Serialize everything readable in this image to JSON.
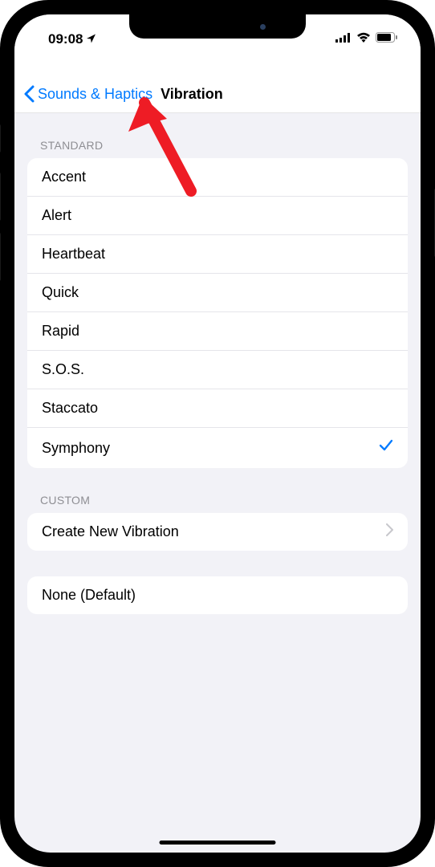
{
  "status_bar": {
    "time": "09:08"
  },
  "nav": {
    "back_label": "Sounds & Haptics",
    "title": "Vibration"
  },
  "sections": {
    "standard": {
      "header": "STANDARD",
      "items": [
        {
          "label": "Accent",
          "selected": false
        },
        {
          "label": "Alert",
          "selected": false
        },
        {
          "label": "Heartbeat",
          "selected": false
        },
        {
          "label": "Quick",
          "selected": false
        },
        {
          "label": "Rapid",
          "selected": false
        },
        {
          "label": "S.O.S.",
          "selected": false
        },
        {
          "label": "Staccato",
          "selected": false
        },
        {
          "label": "Symphony",
          "selected": true
        }
      ]
    },
    "custom": {
      "header": "CUSTOM",
      "create_label": "Create New Vibration"
    },
    "none": {
      "label": "None (Default)"
    }
  },
  "colors": {
    "accent": "#007AFF",
    "background": "#f2f2f7",
    "annotation": "#ee1c25"
  }
}
